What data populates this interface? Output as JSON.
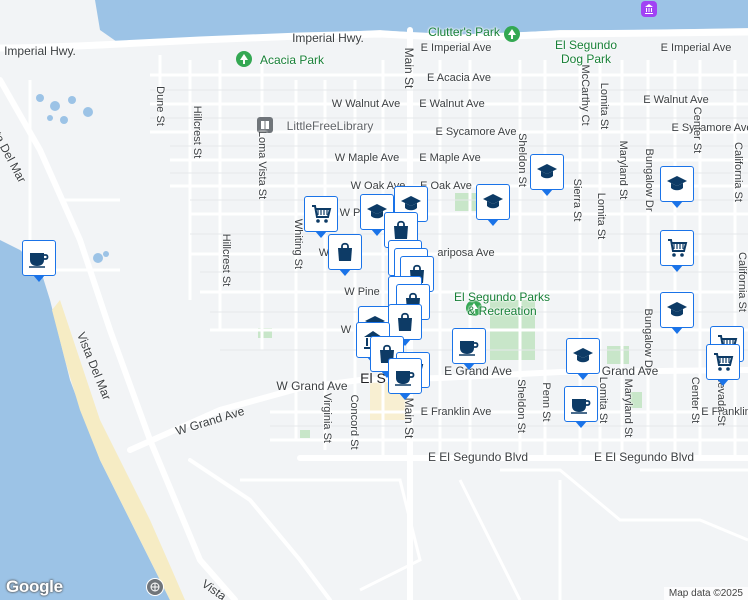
{
  "streets": {
    "imperial_hwy_1": "Imperial Hwy.",
    "imperial_hwy_2": "Imperial Hwy.",
    "e_imperial_ave_1": "E Imperial Ave",
    "e_imperial_ave_2": "E Imperial Ave",
    "e_acacia_ave": "E Acacia Ave",
    "w_walnut_ave": "W Walnut Ave",
    "e_walnut_ave_1": "E Walnut Ave",
    "e_walnut_ave_2": "E Walnut Ave",
    "e_sycamore_ave_1": "E Sycamore Ave",
    "e_sycamore_ave_2": "E Sycamore Ave",
    "w_maple_ave": "W Maple Ave",
    "e_maple_ave": "E Maple Ave",
    "w_oak_ave": "W Oak Ave",
    "e_oak_ave": "E Oak Ave",
    "w_palm": "W P",
    "w_mariposa": "W",
    "mariposa_ave": "ariposa Ave",
    "w_pine": "W Pine",
    "w_holly": "W",
    "w_grand_ave_1": "W Grand Ave",
    "w_grand_ave_2": "W Grand Ave",
    "e_grand_ave_1": "E Grand Ave",
    "e_grand_ave_2": "Grand Ave",
    "e_franklin_ave_1": "E Franklin Ave",
    "e_franklin_ave_2": "E Franklin",
    "e_el_segundo_blvd_1": "E El Segundo Blvd",
    "e_el_segundo_blvd_2": "E El Segundo Blvd",
    "main_st_1": "Main St",
    "main_st_2": "Main St",
    "el_segundo_city": "El S",
    "dune_st": "Dune St",
    "hillcrest_st_1": "Hillcrest St",
    "hillcrest_st_2": "Hillcrest St",
    "loma_vista_st": "Loma Vista St",
    "whiting_st": "Whiting St",
    "virginia_st": "Virginia St",
    "concord_st": "Concord St",
    "sheldon_st_1": "Sheldon St",
    "sheldon_st_2": "Sheldon St",
    "mccarthy_ct": "McCarthy Ct",
    "lomita_st_1": "Lomita St",
    "lomita_st_2": "Lomita St",
    "lomita_st_3": "Lomita St",
    "maryland_st_1": "Maryland St",
    "maryland_st_2": "Maryland St",
    "bungalow_dr_1": "Bungalow Dr",
    "bungalow_dr_2": "Bungalow Dr",
    "center_st_1": "Center St",
    "center_st_2": "Center St",
    "california_st_1": "California St",
    "california_st_2": "California St",
    "sierra_st": "Sierra St",
    "penn_st": "Penn St",
    "nevada_st": "Nevada St",
    "vista_del_mar_1": "Vista Del Mar",
    "vista_del_mar_2": "Vista Del Mar",
    "vista_del_mar_3": "Vista"
  },
  "places": {
    "clutters_park": "Clutter's Park",
    "el_segundo_dog_park": "El Segundo\nDog Park",
    "acacia_park": "Acacia Park",
    "little_free_library": "LittleFreeLibrary",
    "parks_recreation": "El Segundo Parks\n& Recreation"
  },
  "icons": {
    "shopping_cart": "shopping-cart-icon",
    "graduation_cap": "graduation-cap-icon",
    "shopping_bag": "shopping-bag-icon",
    "coffee_cup": "coffee-cup-icon",
    "bank": "bank-icon",
    "park_tree": "park-tree-icon",
    "book": "book-icon"
  },
  "colors": {
    "water": "#9cc3e6",
    "park": "#c8e6c9",
    "road": "#ffffff",
    "marker_border": "#1a73e8",
    "marker_dark": "#0d3b66",
    "park_label": "#188038"
  },
  "branding": {
    "logo": "Google",
    "attribution": "Map data ©2025"
  }
}
